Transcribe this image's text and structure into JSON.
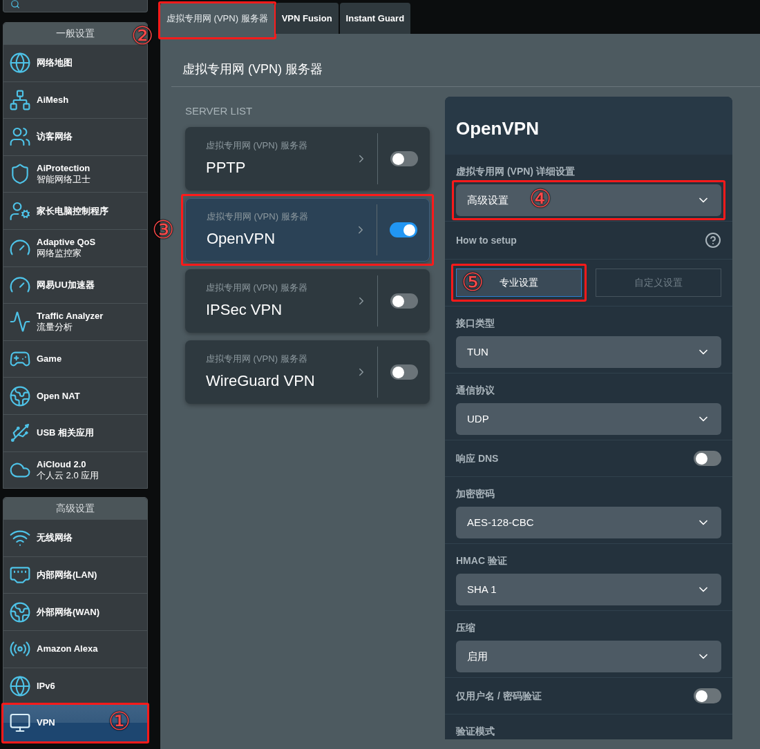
{
  "sidebar": {
    "sections": [
      {
        "title": "一般设置",
        "items": [
          {
            "label": "网络地图",
            "selected": false
          },
          {
            "label": "AiMesh",
            "selected": false
          },
          {
            "label": "访客网络",
            "selected": false
          },
          {
            "label": "AiProtection",
            "sublabel": "智能网络卫士",
            "selected": false
          },
          {
            "label": "家长电脑控制程序",
            "selected": false
          },
          {
            "label": "Adaptive QoS",
            "sublabel": "网络监控家",
            "selected": false
          },
          {
            "label": "网易UU加速器",
            "selected": false
          },
          {
            "label": "Traffic Analyzer",
            "sublabel": "流量分析",
            "selected": false
          },
          {
            "label": "Game",
            "selected": false
          },
          {
            "label": "Open NAT",
            "selected": false
          },
          {
            "label": "USB 相关应用",
            "selected": false
          },
          {
            "label": "AiCloud 2.0",
            "sublabel": "个人云 2.0 应用",
            "selected": false
          }
        ]
      },
      {
        "title": "高级设置",
        "items": [
          {
            "label": "无线网络",
            "selected": false
          },
          {
            "label": "内部网络(LAN)",
            "selected": false
          },
          {
            "label": "外部网络(WAN)",
            "selected": false
          },
          {
            "label": "Amazon Alexa",
            "selected": false
          },
          {
            "label": "IPv6",
            "selected": false
          },
          {
            "label": "VPN",
            "selected": true,
            "callout": "①"
          }
        ]
      }
    ]
  },
  "tabs": [
    {
      "label": "虚拟专用网 (VPN) 服务器",
      "selected": true,
      "callout": "②"
    },
    {
      "label": "VPN Fusion",
      "selected": false
    },
    {
      "label": "Instant Guard",
      "selected": false
    }
  ],
  "page_title": "虚拟专用网 (VPN) 服务器",
  "server_list": {
    "heading": "SERVER LIST",
    "servers": [
      {
        "caption": "虚拟专用网 (VPN) 服务器",
        "name": "PPTP",
        "selected": false,
        "on": false
      },
      {
        "caption": "虚拟专用网 (VPN) 服务器",
        "name": "OpenVPN",
        "selected": true,
        "on": true,
        "callout": "③"
      },
      {
        "caption": "虚拟专用网 (VPN) 服务器",
        "name": "IPSec VPN",
        "selected": false,
        "on": false
      },
      {
        "caption": "虚拟专用网 (VPN) 服务器",
        "name": "WireGuard VPN",
        "selected": false,
        "on": false
      }
    ]
  },
  "settings": {
    "title": "OpenVPN",
    "fields": [
      {
        "kind": "select",
        "label": "虚拟专用网 (VPN) 详细设置",
        "value": "高级设置",
        "callout": "④"
      },
      {
        "kind": "help",
        "label": "How to setup"
      },
      {
        "kind": "buttons",
        "buttons": [
          {
            "label": "专业设置",
            "selected": true,
            "callout": "⑤"
          },
          {
            "label": "自定义设置",
            "selected": false
          }
        ]
      },
      {
        "kind": "select",
        "label": "接口类型",
        "value": "TUN"
      },
      {
        "kind": "select",
        "label": "通信协议",
        "value": "UDP"
      },
      {
        "kind": "toggle",
        "label": "响应 DNS",
        "on": false
      },
      {
        "kind": "select",
        "label": "加密密码",
        "value": "AES-128-CBC"
      },
      {
        "kind": "select",
        "label": "HMAC 验证",
        "value": "SHA 1"
      },
      {
        "kind": "select",
        "label": "压缩",
        "value": "启用"
      },
      {
        "kind": "toggle",
        "label": "仅用户名 / 密码验证",
        "on": false
      },
      {
        "kind": "label",
        "label": "验证模式"
      }
    ]
  }
}
